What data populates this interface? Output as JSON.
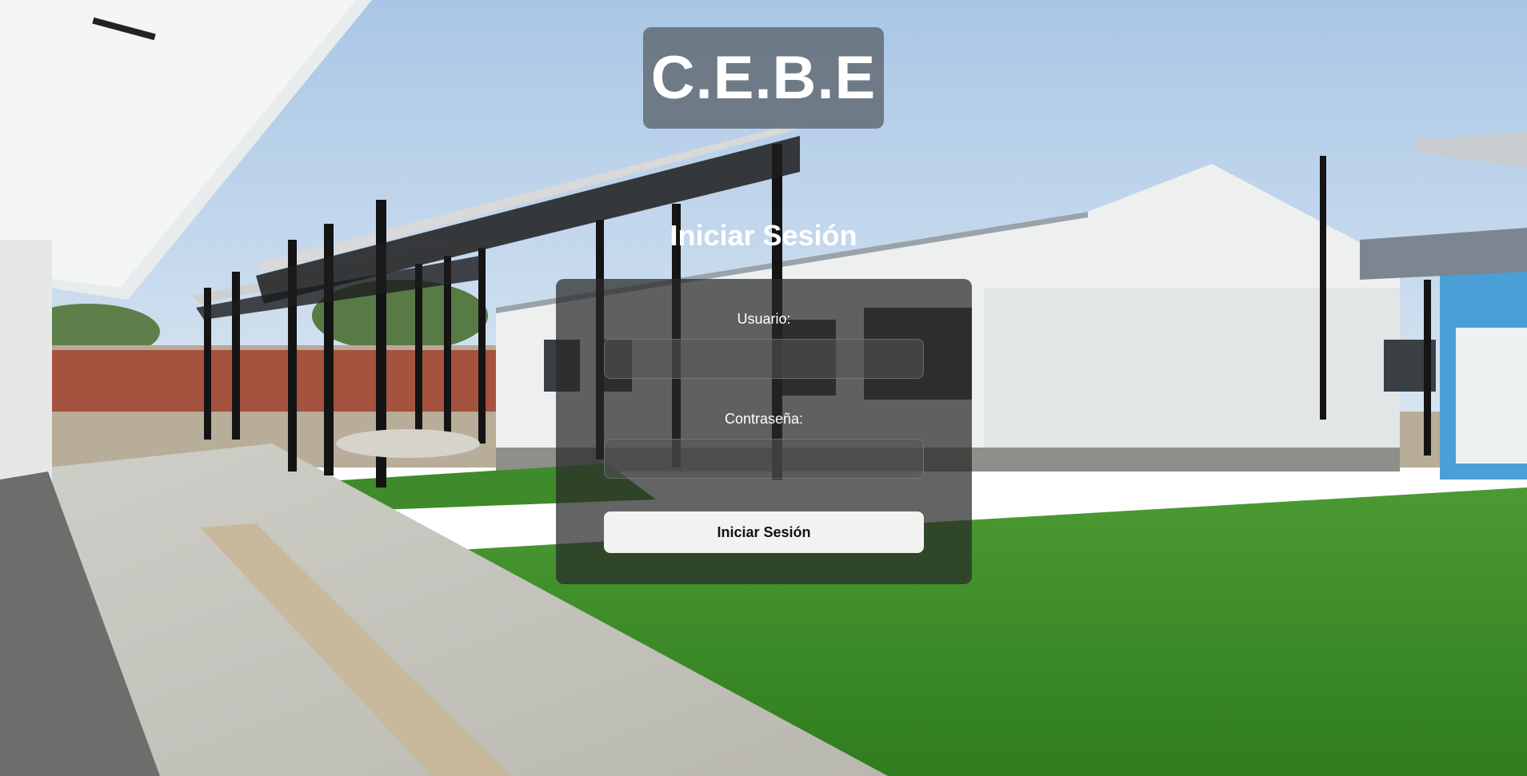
{
  "header": {
    "logo_text": "C.E.B.E"
  },
  "login": {
    "title": "Iniciar Sesión",
    "username_label": "Usuario:",
    "username_value": "",
    "password_label": "Contraseña:",
    "password_value": "",
    "submit_label": "Iniciar Sesión"
  },
  "colors": {
    "logo_background": "#6b737b",
    "card_background": "#2e2e2e",
    "button_background": "#f2f2f0",
    "grass": "#3f8f2a",
    "sky": "#b9d1ea"
  }
}
